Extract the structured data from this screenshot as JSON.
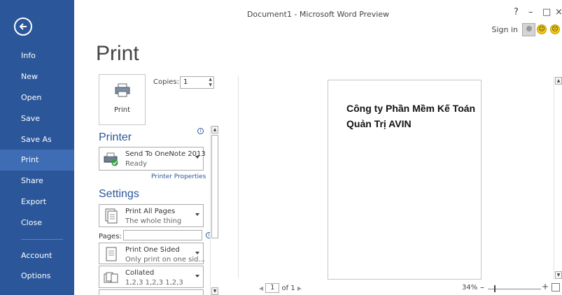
{
  "window": {
    "title": "Document1 - Microsoft Word Preview",
    "help": "?",
    "minimize": "–",
    "maximize": "□",
    "close": "×",
    "sign_in": "Sign in",
    "smile": "☺",
    "frown": "☹"
  },
  "nav": {
    "items": [
      "Info",
      "New",
      "Open",
      "Save",
      "Save As",
      "Print",
      "Share",
      "Export",
      "Close",
      "Account",
      "Options"
    ],
    "active": "Print"
  },
  "print": {
    "page_title": "Print",
    "button_label": "Print",
    "copies_label": "Copies:",
    "copies_value": "1",
    "printer_section": "Printer",
    "printer_name": "Send To OneNote 2013",
    "printer_status": "Ready",
    "printer_properties": "Printer Properties",
    "settings_section": "Settings",
    "setting1_main": "Print All Pages",
    "setting1_sub": "The whole thing",
    "pages_label": "Pages:",
    "pages_value": "",
    "setting2_main": "Print One Sided",
    "setting2_sub": "Only print on one sid...",
    "setting3_main": "Collated",
    "setting3_sub": "1,2,3   1,2,3   1,2,3"
  },
  "preview": {
    "doc_text": "Công ty Phần Mềm Kế Toán Quản Trị AVIN",
    "page_current": "1",
    "page_of": "of 1",
    "zoom": "34%"
  },
  "colors": {
    "nav_bg": "#2b579a",
    "nav_active": "#3e6db5",
    "accent": "#2b579a"
  }
}
